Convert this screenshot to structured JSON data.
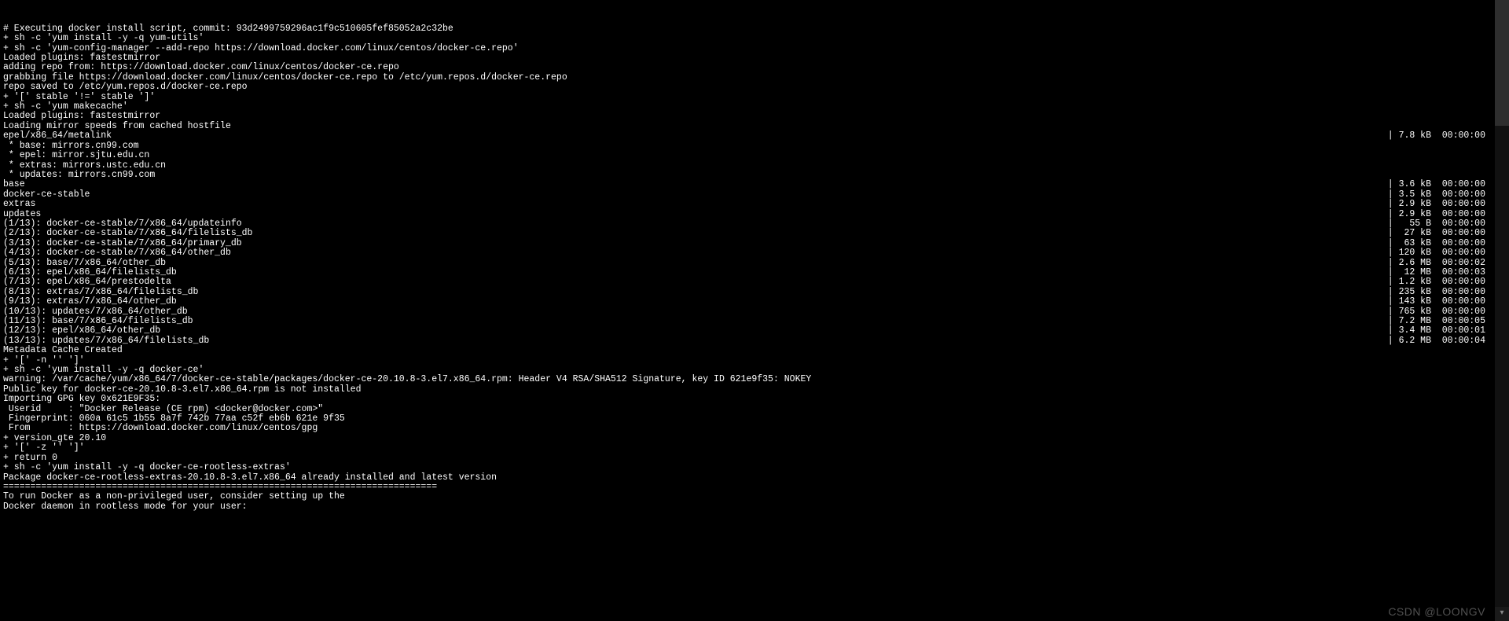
{
  "watermark": "CSDN @LOONGV",
  "lines": [
    {
      "left": "# Executing docker install script, commit: 93d2499759296ac1f9c510605fef85052a2c32be"
    },
    {
      "left": "+ sh -c 'yum install -y -q yum-utils'"
    },
    {
      "left": "+ sh -c 'yum-config-manager --add-repo https://download.docker.com/linux/centos/docker-ce.repo'"
    },
    {
      "left": "Loaded plugins: fastestmirror"
    },
    {
      "left": "adding repo from: https://download.docker.com/linux/centos/docker-ce.repo"
    },
    {
      "left": "grabbing file https://download.docker.com/linux/centos/docker-ce.repo to /etc/yum.repos.d/docker-ce.repo"
    },
    {
      "left": "repo saved to /etc/yum.repos.d/docker-ce.repo"
    },
    {
      "left": "+ '[' stable '!=' stable ']'"
    },
    {
      "left": "+ sh -c 'yum makecache'"
    },
    {
      "left": "Loaded plugins: fastestmirror"
    },
    {
      "left": "Loading mirror speeds from cached hostfile"
    },
    {
      "left": "epel/x86_64/metalink",
      "right": "| 7.8 kB  00:00:00"
    },
    {
      "left": " * base: mirrors.cn99.com"
    },
    {
      "left": " * epel: mirror.sjtu.edu.cn"
    },
    {
      "left": " * extras: mirrors.ustc.edu.cn"
    },
    {
      "left": " * updates: mirrors.cn99.com"
    },
    {
      "left": "base",
      "right": "| 3.6 kB  00:00:00"
    },
    {
      "left": "docker-ce-stable",
      "right": "| 3.5 kB  00:00:00"
    },
    {
      "left": "extras",
      "right": "| 2.9 kB  00:00:00"
    },
    {
      "left": "updates",
      "right": "| 2.9 kB  00:00:00"
    },
    {
      "left": "(1/13): docker-ce-stable/7/x86_64/updateinfo",
      "right": "|   55 B  00:00:00"
    },
    {
      "left": "(2/13): docker-ce-stable/7/x86_64/filelists_db",
      "right": "|  27 kB  00:00:00"
    },
    {
      "left": "(3/13): docker-ce-stable/7/x86_64/primary_db",
      "right": "|  63 kB  00:00:00"
    },
    {
      "left": "(4/13): docker-ce-stable/7/x86_64/other_db",
      "right": "| 120 kB  00:00:00"
    },
    {
      "left": "(5/13): base/7/x86_64/other_db",
      "right": "| 2.6 MB  00:00:02"
    },
    {
      "left": "(6/13): epel/x86_64/filelists_db",
      "right": "|  12 MB  00:00:03"
    },
    {
      "left": "(7/13): epel/x86_64/prestodelta",
      "right": "| 1.2 kB  00:00:00"
    },
    {
      "left": "(8/13): extras/7/x86_64/filelists_db",
      "right": "| 235 kB  00:00:00"
    },
    {
      "left": "(9/13): extras/7/x86_64/other_db",
      "right": "| 143 kB  00:00:00"
    },
    {
      "left": "(10/13): updates/7/x86_64/other_db",
      "right": "| 765 kB  00:00:00"
    },
    {
      "left": "(11/13): base/7/x86_64/filelists_db",
      "right": "| 7.2 MB  00:00:05"
    },
    {
      "left": "(12/13): epel/x86_64/other_db",
      "right": "| 3.4 MB  00:00:01"
    },
    {
      "left": "(13/13): updates/7/x86_64/filelists_db",
      "right": "| 6.2 MB  00:00:04"
    },
    {
      "left": "Metadata Cache Created"
    },
    {
      "left": "+ '[' -n '' ']'"
    },
    {
      "left": "+ sh -c 'yum install -y -q docker-ce'"
    },
    {
      "left": "warning: /var/cache/yum/x86_64/7/docker-ce-stable/packages/docker-ce-20.10.8-3.el7.x86_64.rpm: Header V4 RSA/SHA512 Signature, key ID 621e9f35: NOKEY"
    },
    {
      "left": "Public key for docker-ce-20.10.8-3.el7.x86_64.rpm is not installed"
    },
    {
      "left": "Importing GPG key 0x621E9F35:"
    },
    {
      "left": " Userid     : \"Docker Release (CE rpm) <docker@docker.com>\""
    },
    {
      "left": " Fingerprint: 060a 61c5 1b55 8a7f 742b 77aa c52f eb6b 621e 9f35"
    },
    {
      "left": " From       : https://download.docker.com/linux/centos/gpg"
    },
    {
      "left": "+ version_gte 20.10"
    },
    {
      "left": "+ '[' -z '' ']'"
    },
    {
      "left": "+ return 0"
    },
    {
      "left": "+ sh -c 'yum install -y -q docker-ce-rootless-extras'"
    },
    {
      "left": "Package docker-ce-rootless-extras-20.10.8-3.el7.x86_64 already installed and latest version"
    },
    {
      "left": ""
    },
    {
      "left": "================================================================================"
    },
    {
      "left": ""
    },
    {
      "left": "To run Docker as a non-privileged user, consider setting up the"
    },
    {
      "left": "Docker daemon in rootless mode for your user:"
    }
  ]
}
